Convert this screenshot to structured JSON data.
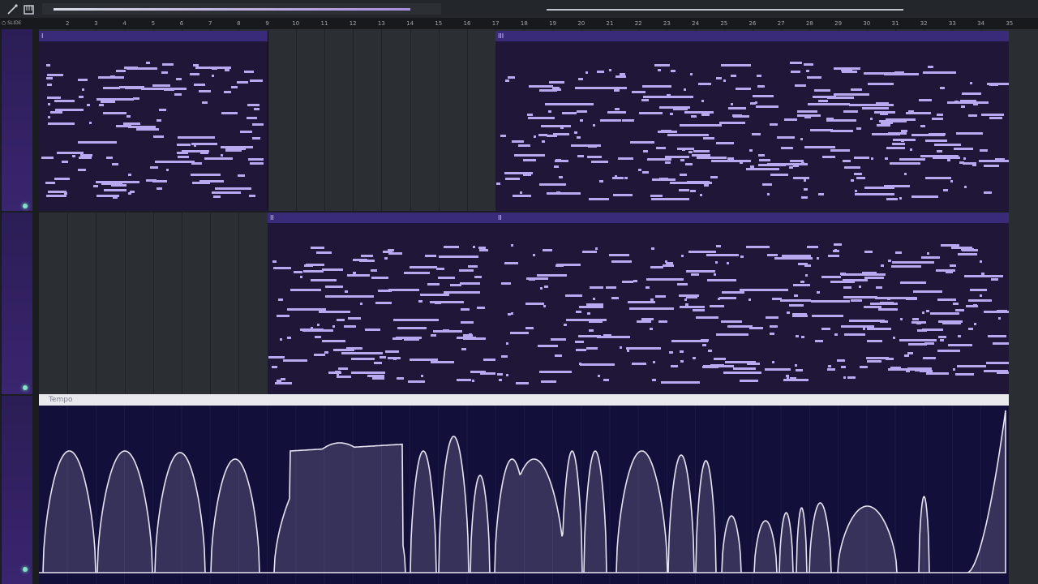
{
  "toolbar": {
    "snap_label": "SLIDE",
    "tools": [
      "wand-icon",
      "piano-icon"
    ]
  },
  "ruler": {
    "bars": [
      "2",
      "3",
      "4",
      "5",
      "6",
      "7",
      "8",
      "9",
      "10",
      "11",
      "12",
      "13",
      "14",
      "15",
      "16",
      "17",
      "18",
      "19",
      "20",
      "21",
      "22",
      "23",
      "24",
      "25",
      "26",
      "27",
      "28",
      "29",
      "30",
      "31",
      "32",
      "33",
      "34",
      "35"
    ]
  },
  "clips": [
    {
      "label": "I",
      "lane": 0
    },
    {
      "label": "III",
      "lane": 0
    },
    {
      "label": "II",
      "lane": 1
    },
    {
      "label": "II",
      "lane": 1
    }
  ],
  "automation": {
    "label": "Tempo"
  },
  "colors": {
    "accent": "#3a2a7a",
    "note": "#b7a8ef",
    "background": "#1f2226",
    "led": "#7fe3c8"
  }
}
